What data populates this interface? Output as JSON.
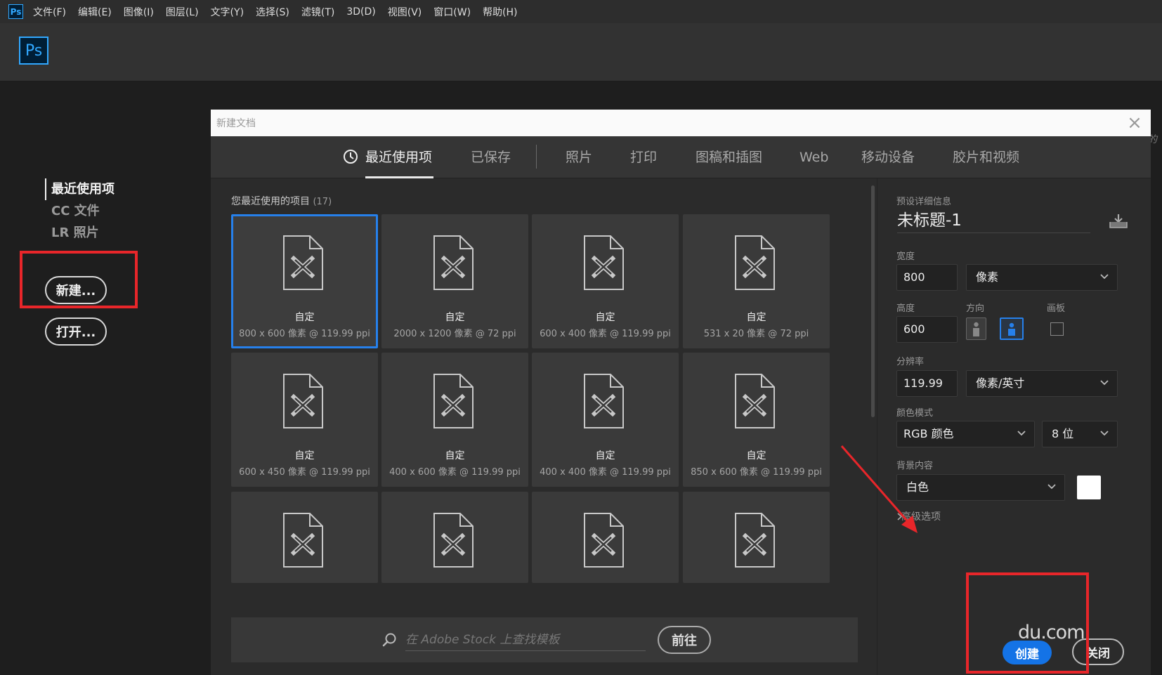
{
  "menubar": {
    "app_icon": "Ps",
    "items": [
      "文件(F)",
      "编辑(E)",
      "图像(I)",
      "图层(L)",
      "文字(Y)",
      "选择(S)",
      "滤镜(T)",
      "3D(D)",
      "视图(V)",
      "窗口(W)",
      "帮助(H)"
    ]
  },
  "header": {
    "logo": "Ps"
  },
  "home": {
    "nav": [
      "最近使用项",
      "CC 文件",
      "LR 照片"
    ],
    "new_button": "新建...",
    "open_button": "打开..."
  },
  "dialog": {
    "title": "新建文档",
    "close": "×",
    "tabs": [
      "最近使用项",
      "已保存",
      "照片",
      "打印",
      "图稿和插图",
      "Web",
      "移动设备",
      "胶片和视频"
    ],
    "recent_label": "您最近使用的项目",
    "recent_count": "(17)",
    "presets": [
      {
        "name": "自定",
        "meta": "800 x 600 像素 @ 119.99 ppi"
      },
      {
        "name": "自定",
        "meta": "2000 x 1200 像素 @ 72 ppi"
      },
      {
        "name": "自定",
        "meta": "600 x 400 像素 @ 119.99 ppi"
      },
      {
        "name": "自定",
        "meta": "531 x 20 像素 @ 72 ppi"
      },
      {
        "name": "自定",
        "meta": "600 x 450 像素 @ 119.99 ppi"
      },
      {
        "name": "自定",
        "meta": "400 x 600 像素 @ 119.99 ppi"
      },
      {
        "name": "自定",
        "meta": "400 x 400 像素 @ 119.99 ppi"
      },
      {
        "name": "自定",
        "meta": "850 x 600 像素 @ 119.99 ppi"
      },
      {
        "name": "",
        "meta": ""
      },
      {
        "name": "",
        "meta": ""
      },
      {
        "name": "",
        "meta": ""
      },
      {
        "name": "",
        "meta": ""
      }
    ],
    "search_placeholder": "在 Adobe Stock 上查找模板",
    "go_button": "前往"
  },
  "details": {
    "section_label": "预设详细信息",
    "doc_title": "未标题-1",
    "width_label": "宽度",
    "width_value": "800",
    "width_unit": "像素",
    "height_label": "高度",
    "height_value": "600",
    "orientation_label": "方向",
    "artboard_label": "画板",
    "resolution_label": "分辨率",
    "resolution_value": "119.99",
    "resolution_unit": "像素/英寸",
    "color_mode_label": "颜色模式",
    "color_mode": "RGB 颜色",
    "bit_depth": "8 位",
    "background_label": "背景内容",
    "background": "白色",
    "advanced": "高级选项",
    "create_button": "创建",
    "close_button": "关闭"
  },
  "watermark": "du.com",
  "colors": {
    "accent": "#2680eb",
    "annotation": "#e8262a"
  }
}
